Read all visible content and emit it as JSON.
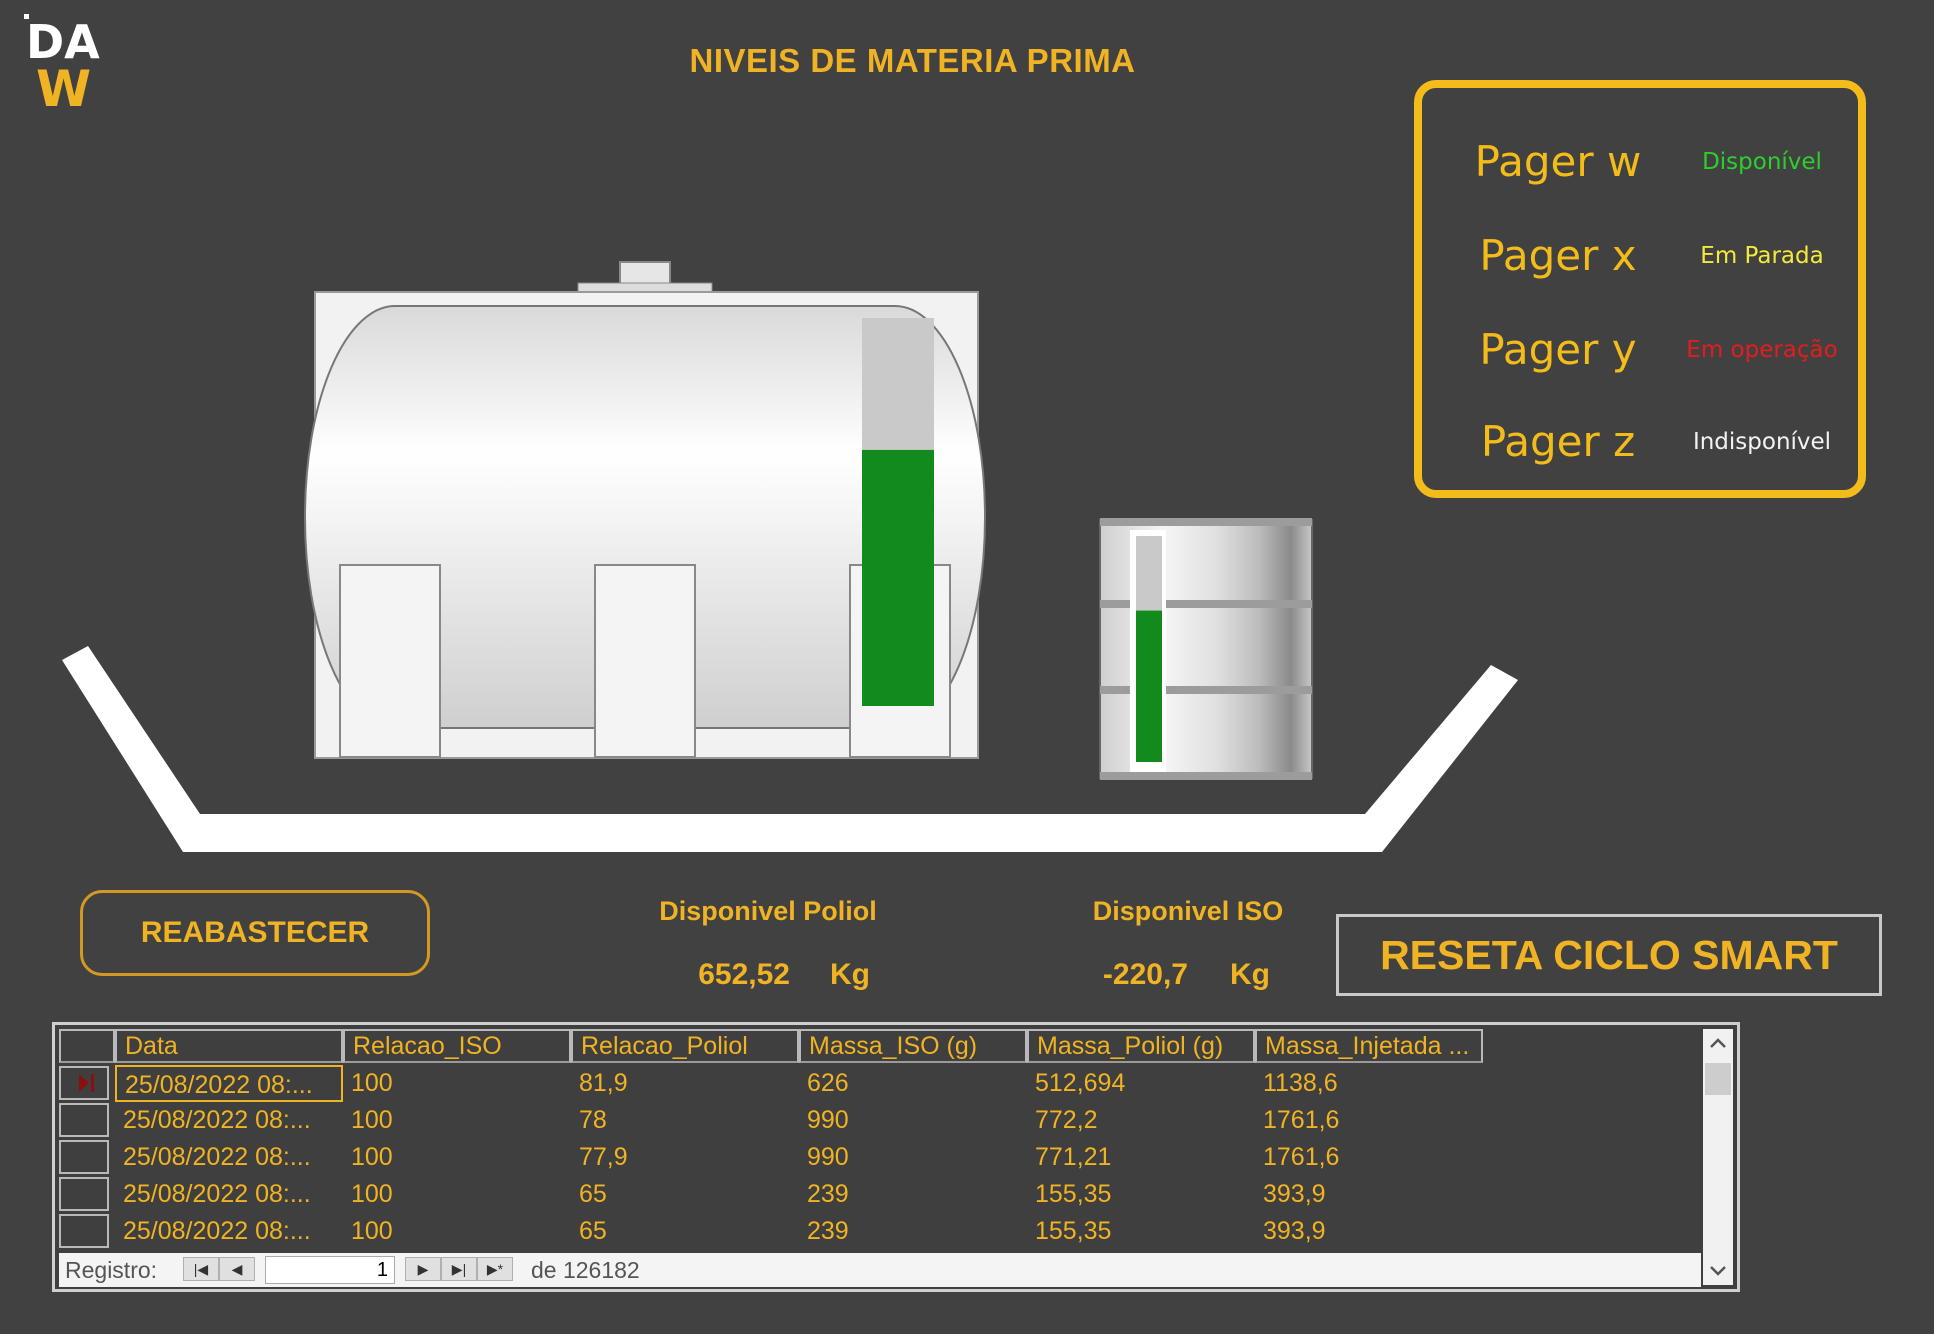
{
  "header": {
    "logo_text_top": "DA",
    "logo_text_bottom": "W",
    "title": "NIVEIS DE MATERIA PRIMA"
  },
  "pagers": [
    {
      "name": "Pager w",
      "status": "Disponível",
      "color": "#2ccf2c"
    },
    {
      "name": "Pager x",
      "status": "Em Parada",
      "color": "#f4ea3b"
    },
    {
      "name": "Pager y",
      "status": "Em operação",
      "color": "#e51c1c"
    },
    {
      "name": "Pager z",
      "status": "Indisponível",
      "color": "#f2f2f2"
    }
  ],
  "tanks": {
    "poliol_level_fraction": 0.66,
    "iso_level_fraction": 0.67
  },
  "controls": {
    "reabastecer_label": "REABASTECER",
    "reseta_label": "RESETA CICLO SMART"
  },
  "availability": {
    "poliol_label": "Disponivel Poliol",
    "poliol_value": "652,52",
    "poliol_unit": "Kg",
    "iso_label": "Disponivel ISO",
    "iso_value": "-220,7",
    "iso_unit": "Kg"
  },
  "table": {
    "columns": [
      "Data",
      "Relacao_ISO",
      "Relacao_Poliol",
      "Massa_ISO (g)",
      "Massa_Poliol (g)",
      "Massa_Injetada ..."
    ],
    "rows": [
      [
        "25/08/2022 08:...",
        "100",
        "81,9",
        "626",
        "512,694",
        "1138,6"
      ],
      [
        "25/08/2022 08:...",
        "100",
        "78",
        "990",
        "772,2",
        "1761,6"
      ],
      [
        "25/08/2022 08:...",
        "100",
        "77,9",
        "990",
        "771,21",
        "1761,6"
      ],
      [
        "25/08/2022 08:...",
        "100",
        "65",
        "239",
        "155,35",
        "393,9"
      ],
      [
        "25/08/2022 08:...",
        "100",
        "65",
        "239",
        "155,35",
        "393,9"
      ]
    ],
    "nav": {
      "label": "Registro:",
      "current": "1",
      "total_text": "de 126182"
    }
  },
  "colors": {
    "background": "#414141",
    "accent": "#f0b323",
    "level_fill": "#138a1d",
    "level_empty": "#c9c9c9"
  }
}
